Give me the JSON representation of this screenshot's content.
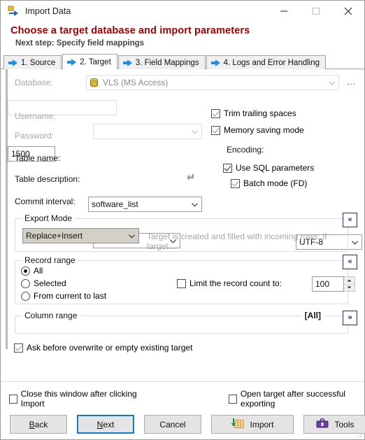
{
  "window": {
    "title": "Import Data",
    "icon": "import-data-icon",
    "controls": {
      "minimize": "minimize-icon",
      "maximize": "maximize-icon",
      "close": "close-icon"
    }
  },
  "heading": {
    "main": "Choose a target database and import parameters",
    "sub": "Next step: Specify field mappings"
  },
  "tabs": [
    {
      "label": "1. Source",
      "active": false
    },
    {
      "label": "2. Target",
      "active": true
    },
    {
      "label": "3. Field Mappings",
      "active": false
    },
    {
      "label": "4. Logs and Error Handling",
      "active": false
    }
  ],
  "form": {
    "database_label": "Database:",
    "database_value": "VLS (MS Access)",
    "database_browse": "...",
    "username_label": "Username:",
    "username_value": "",
    "password_label": "Password:",
    "password_value": "",
    "table_name_label": "Table name:",
    "table_name_value": "software_list",
    "table_description_label": "Table description:",
    "table_description_value": "",
    "table_description_reset": "revert-icon",
    "commit_interval_label": "Commit interval:",
    "commit_interval_value": "1500",
    "trim_trailing_spaces": "Trim trailing spaces",
    "memory_saving_mode": "Memory saving mode",
    "encoding_label": "Encoding:",
    "encoding_value": "UTF-8",
    "use_sql_parameters": "Use SQL parameters",
    "batch_mode": "Batch mode (FD)"
  },
  "export_mode": {
    "title": "Export Mode",
    "value": "Replace+Insert",
    "hint": "Target is created and filled with incoming rows; if target...",
    "collapse": "«"
  },
  "record_range": {
    "title": "Record range",
    "options": [
      "All",
      "Selected",
      "From current to last"
    ],
    "selected": "All",
    "limit_label": "Limit the record count to:",
    "limit_value": "100",
    "collapse": "«"
  },
  "column_range": {
    "title": "Column range",
    "value": "[All]",
    "expand": "»"
  },
  "ask_before_overwrite": "Ask before overwrite or empty existing target",
  "footer": {
    "close_after_import": "Close this window after clicking Import",
    "open_target_after_export": "Open target after successful exporting",
    "back": "Back",
    "back_accel": "B",
    "next": "Next",
    "next_accel": "N",
    "cancel": "Cancel",
    "import": "Import",
    "tools": "Tools",
    "tools_caret": "▼"
  },
  "colors": {
    "heading": "#9b0000",
    "accent_blue": "#0a7ad4",
    "tab_arrow": "#1e90e8",
    "navy": "#1f2d6e"
  }
}
